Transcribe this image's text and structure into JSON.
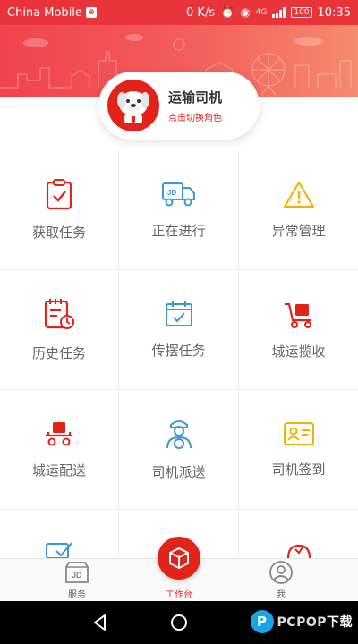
{
  "status_bar": {
    "carrier": "China Mobile",
    "speed": "0 K/s",
    "network": "4G",
    "battery": "100",
    "time": "10:35"
  },
  "role": {
    "title": "运输司机",
    "subtitle": "点击切换角色"
  },
  "grid": [
    {
      "label": "获取任务",
      "icon": "clipboard-check-icon",
      "color": "#e2231a"
    },
    {
      "label": "正在进行",
      "icon": "truck-icon",
      "color": "#3a9ad9"
    },
    {
      "label": "异常管理",
      "icon": "warning-triangle-icon",
      "color": "#f0b400"
    },
    {
      "label": "历史任务",
      "icon": "history-clipboard-icon",
      "color": "#e2231a"
    },
    {
      "label": "传摆任务",
      "icon": "calendar-check-icon",
      "color": "#3a9ad9"
    },
    {
      "label": "城运揽收",
      "icon": "hand-cart-icon",
      "color": "#e2231a"
    },
    {
      "label": "城运配送",
      "icon": "delivery-cart-icon",
      "color": "#e2231a"
    },
    {
      "label": "司机派送",
      "icon": "driver-icon",
      "color": "#3a9ad9"
    },
    {
      "label": "司机签到",
      "icon": "id-card-icon",
      "color": "#f0b400"
    }
  ],
  "bottom_nav": {
    "service": "服务",
    "work": "工作台",
    "me": "我",
    "service_badge": "JD"
  },
  "watermark": {
    "text": "PCPOP",
    "cn": "下载",
    "letter": "P"
  }
}
